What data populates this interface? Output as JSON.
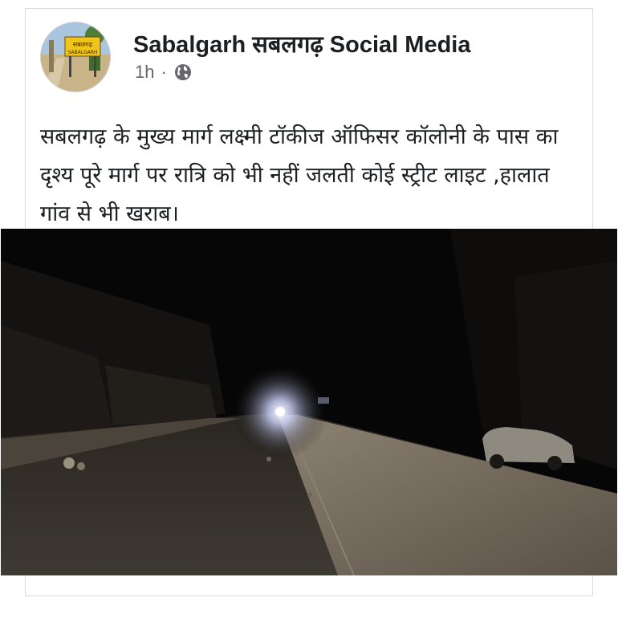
{
  "post": {
    "author": "Sabalgarh सबलगढ़  Social Media",
    "timestamp": "1h",
    "separator": "·",
    "privacy_icon": "globe-icon",
    "text": "सबलगढ़ के मुख्य मार्ग लक्ष्मी टॉकीज ऑफिसर कॉलोनी के पास का दृश्य पूरे मार्ग पर रात्रि को भी नहीं जलती कोई स्ट्रीट लाइट ,हालात गांव से भी खराब।"
  },
  "avatar": {
    "sign_text_hindi": "सबलगढ़",
    "sign_text_english": "SABALGARH"
  },
  "colors": {
    "author_text": "#1c1e21",
    "meta_text": "#65676b",
    "card_border": "#d9d9d9"
  }
}
